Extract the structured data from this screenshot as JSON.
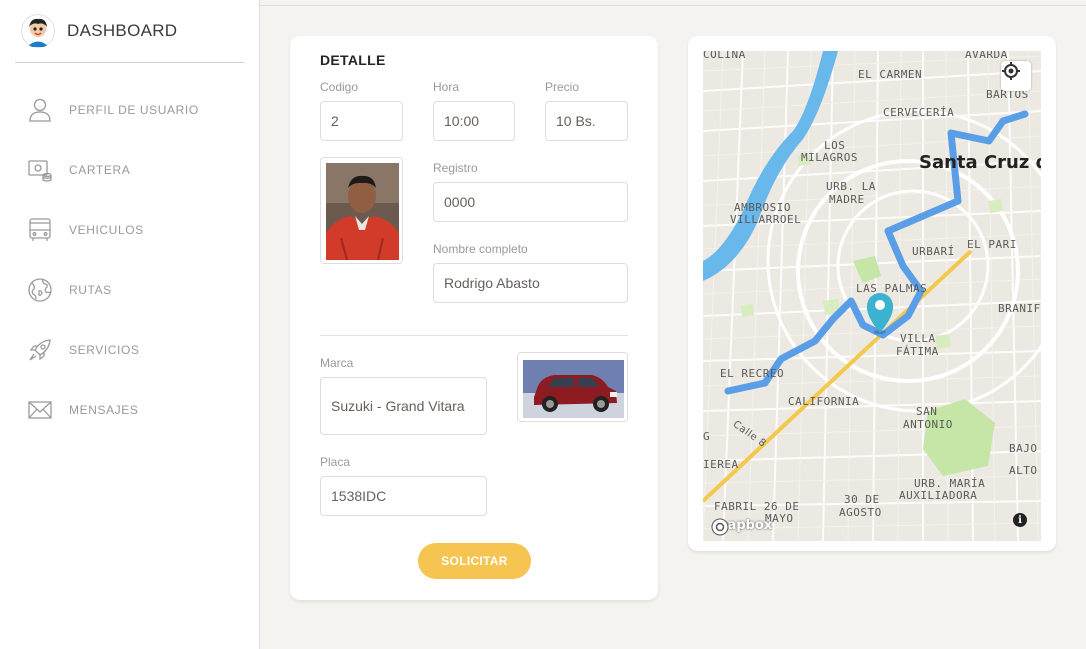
{
  "brand": {
    "title": "DASHBOARD",
    "avatar_icon": "user-avatar-icon"
  },
  "sidebar": {
    "items": [
      {
        "label": "PERFIL DE USUARIO",
        "icon": "user-icon"
      },
      {
        "label": "CARTERA",
        "icon": "wallet-icon"
      },
      {
        "label": "VEHICULOS",
        "icon": "bus-icon"
      },
      {
        "label": "RUTAS",
        "icon": "globe-icon"
      },
      {
        "label": "SERVICIOS",
        "icon": "rocket-icon"
      },
      {
        "label": "MENSAJES",
        "icon": "envelope-icon"
      }
    ]
  },
  "detail": {
    "title": "DETALLE",
    "codigo": {
      "label": "Codigo",
      "value": "2"
    },
    "hora": {
      "label": "Hora",
      "value": "10:00"
    },
    "precio": {
      "label": "Precio",
      "value": "10 Bs."
    },
    "registro": {
      "label": "Registro",
      "value": "0000"
    },
    "nombre": {
      "label": "Nombre completo",
      "value": "Rodrigo Abasto"
    },
    "marca": {
      "label": "Marca",
      "value": "Suzuki - Grand Vitara"
    },
    "placa": {
      "label": "Placa",
      "value": "1538IDC"
    },
    "submit_label": "SOLICITAR"
  },
  "map": {
    "labels": {
      "colina": "COLINA",
      "avarda": "AVARDA",
      "el_carmen": "EL CARMEN",
      "bartos": "BARTOS",
      "cerveceria": "CERVECERÍA",
      "los": "LOS",
      "milagros": "MILAGROS",
      "santa_cruz": "Santa Cruz de",
      "urb_la": "URB. LA",
      "madre": "MADRE",
      "ambrosio": "AMBROSIO",
      "villarroel": "VILLARROEL",
      "urbari": "URBARÍ",
      "el_pari": "EL PARI",
      "las_palmas": "LAS PALMAS",
      "branif": "BRANIF",
      "villa": "VILLA",
      "fatima": "FÁTIMA",
      "el_recreo": "EL RECREO",
      "california": "CALIFORNIA",
      "calle8": "Calle 8",
      "san": "SAN",
      "antonio": "ANTONIO",
      "bajo": "BAJO",
      "alto": "ALTO",
      "g": "G",
      "ierea": "IEREA",
      "urb_maria": "URB. MARÍA",
      "auxiliadora": "AUXILIADORA",
      "fabril": "FABRIL 26 DE",
      "mayo": "MAYO",
      "treinta": "30 DE",
      "agosto": "AGOSTO"
    },
    "logo": "mapbox",
    "info": "i",
    "locate_icon": "locate-icon",
    "marker_icon": "map-pin-icon",
    "route_color": "#5b9ee8",
    "avenue_color": "#f2c94c",
    "river_color": "#68b8ec"
  },
  "colors": {
    "accent": "#f6c451",
    "sidebar_text": "#9a9a9a"
  }
}
